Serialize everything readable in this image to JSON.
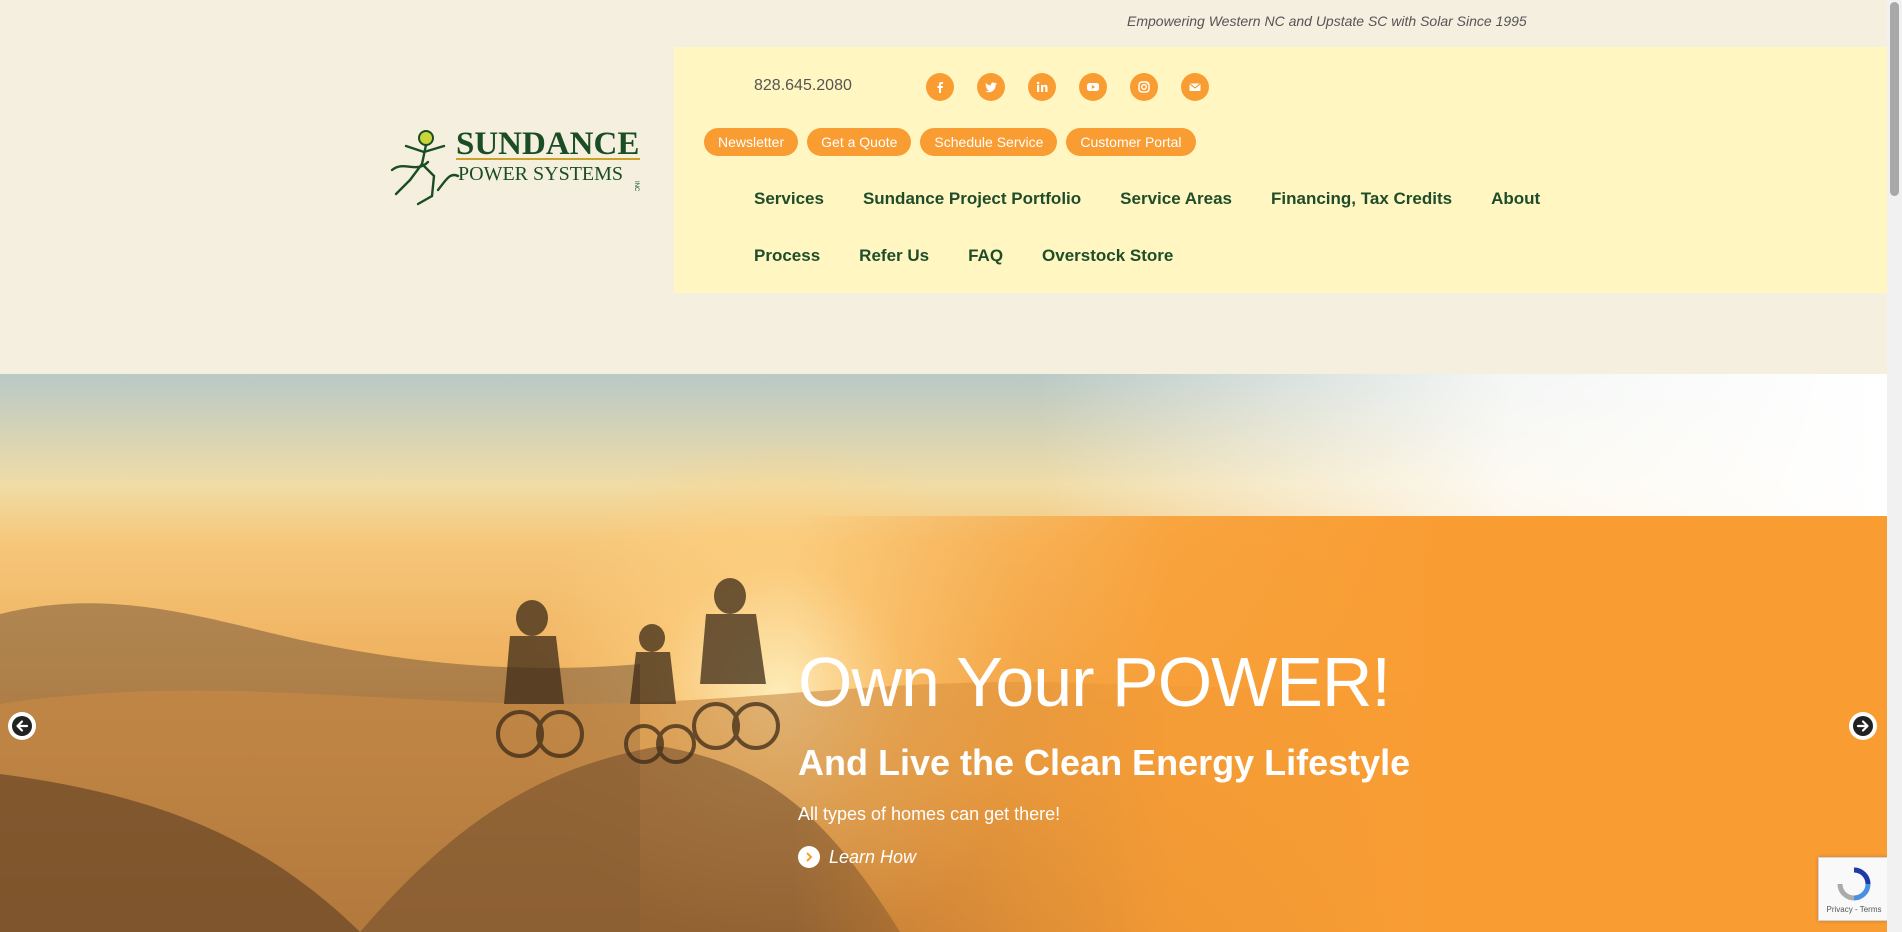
{
  "header": {
    "tagline": "Empowering Western NC and Upstate SC with Solar Since 1995",
    "logo": {
      "title": "SUNDANCE",
      "subtitle": "POWER SYSTEMS",
      "suffix": "INC"
    },
    "phone": "828.645.2080",
    "social_icons": [
      "facebook-icon",
      "twitter-icon",
      "linkedin-icon",
      "youtube-icon",
      "instagram-icon",
      "email-icon"
    ],
    "quick_links": [
      "Newsletter",
      "Get a Quote",
      "Schedule Service",
      "Customer Portal"
    ],
    "nav_row1": [
      "Services",
      "Sundance Project Portfolio",
      "Service Areas",
      "Financing, Tax Credits",
      "About"
    ],
    "nav_row2": [
      "Process",
      "Refer Us",
      "FAQ",
      "Overstock Store"
    ]
  },
  "hero": {
    "title": "Own Your POWER!",
    "subtitle": "And Live the Clean Energy Lifestyle",
    "body": "All types of homes can get there!",
    "link_label": "Learn How",
    "prev_icon": "arrow-left-icon",
    "next_icon": "arrow-right-icon"
  },
  "recaptcha": {
    "text": "Privacy - Terms"
  },
  "colors": {
    "background": "#f5efe0",
    "header_panel": "#fff6c2",
    "accent_orange": "#f99d33",
    "nav_green": "#1f4d2a"
  }
}
